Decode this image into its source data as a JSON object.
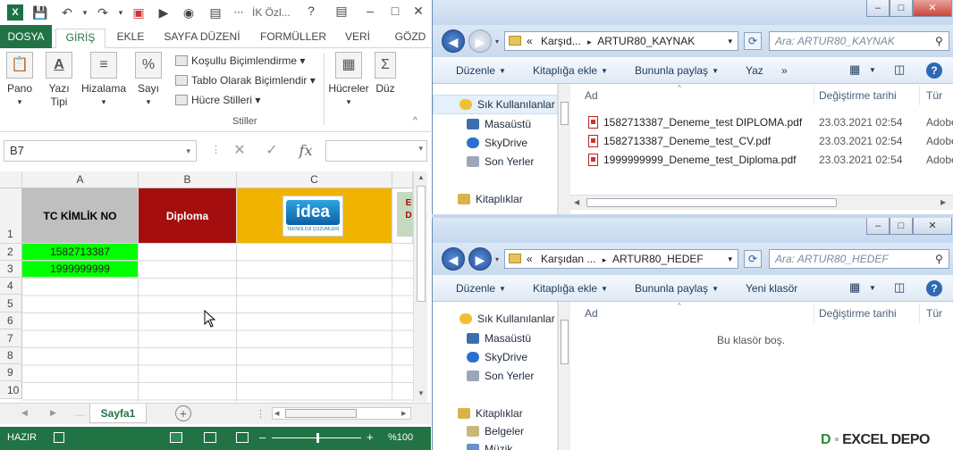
{
  "excel": {
    "quick_access": {
      "save": "save-icon",
      "undo": "undo-icon",
      "redo": "redo-icon"
    },
    "title": "İK Özl...",
    "tabs": [
      "DOSYA",
      "GİRİŞ",
      "EKLE",
      "SAYFA DÜZENİ",
      "FORMÜLLER",
      "VERİ",
      "GÖZD"
    ],
    "active_tab": "GİRİŞ",
    "ribbon": {
      "pano": "Pano",
      "yazi_tipi_1": "Yazı",
      "yazi_tipi_2": "Tipi",
      "hizalama": "Hizalama",
      "sayi": "Sayı",
      "kosullu": "Koşullu Biçimlendirme",
      "tablo": "Tablo Olarak Biçimlendir",
      "hucre_stilleri": "Hücre Stilleri",
      "stiller": "Stiller",
      "hucreler": "Hücreler",
      "duzen": "Düz"
    },
    "name_box": "B7",
    "fx_label": "fx",
    "columns": [
      "A",
      "B",
      "C"
    ],
    "rows": [
      "1",
      "2",
      "3",
      "4",
      "5",
      "6",
      "7",
      "8",
      "9",
      "10"
    ],
    "cells": {
      "a1": "TC KİMLİK NO",
      "b1": "Diploma",
      "c1_logo": "idea",
      "c1_logo_sub": "TEKNOLOJİ ÇÖZÜMLERİ",
      "d1_partial": "E\nD",
      "a2": "1582713387",
      "a3": "1999999999"
    },
    "sheet_tab": "Sayfa1",
    "status": {
      "ready": "HAZIR",
      "zoom": "%100"
    },
    "colors": {
      "green": "#217346",
      "a1_bg": "#bfbfbf",
      "b1_bg": "#a50e0e",
      "c1_bg": "#f0b400",
      "a_data_bg": "#00ff00"
    }
  },
  "explorer_top": {
    "breadcrumb_prefix": "«",
    "breadcrumb_1": "Karşıd...",
    "breadcrumb_sep": "▸",
    "breadcrumb_2": "ARTUR80_KAYNAK",
    "search_placeholder": "Ara: ARTUR80_KAYNAK",
    "commands": [
      "Düzenle",
      "Kitaplığa ekle",
      "Bununla paylaş",
      "Yaz"
    ],
    "more": "»",
    "nav": [
      "Sık Kullanılanlar",
      "Masaüstü",
      "SkyDrive",
      "Son Yerler",
      "Kitaplıklar"
    ],
    "columns": {
      "name": "Ad",
      "date": "Değiştirme tarihi",
      "type": "Tür"
    },
    "files": [
      {
        "name": "1582713387_Deneme_test DIPLOMA.pdf",
        "date": "23.03.2021 02:54",
        "type": "Adobe"
      },
      {
        "name": "1582713387_Deneme_test_CV.pdf",
        "date": "23.03.2021 02:54",
        "type": "Adobe"
      },
      {
        "name": "1999999999_Deneme_test_Diploma.pdf",
        "date": "23.03.2021 02:54",
        "type": "Adobe"
      }
    ]
  },
  "explorer_bottom": {
    "breadcrumb_prefix": "«",
    "breadcrumb_1": "Karşıdan ...",
    "breadcrumb_sep": "▸",
    "breadcrumb_2": "ARTUR80_HEDEF",
    "search_placeholder": "Ara: ARTUR80_HEDEF",
    "commands": [
      "Düzenle",
      "Kitaplığa ekle",
      "Bununla paylaş",
      "Yeni klasör"
    ],
    "nav": [
      "Sık Kullanılanlar",
      "Masaüstü",
      "SkyDrive",
      "Son Yerler",
      "Kitaplıklar",
      "Belgeler",
      "Müzik"
    ],
    "columns": {
      "name": "Ad",
      "date": "Değiştirme tarihi",
      "type": "Tür"
    },
    "empty_message": "Bu klasör boş."
  },
  "watermark": "EXCEL DEPO"
}
